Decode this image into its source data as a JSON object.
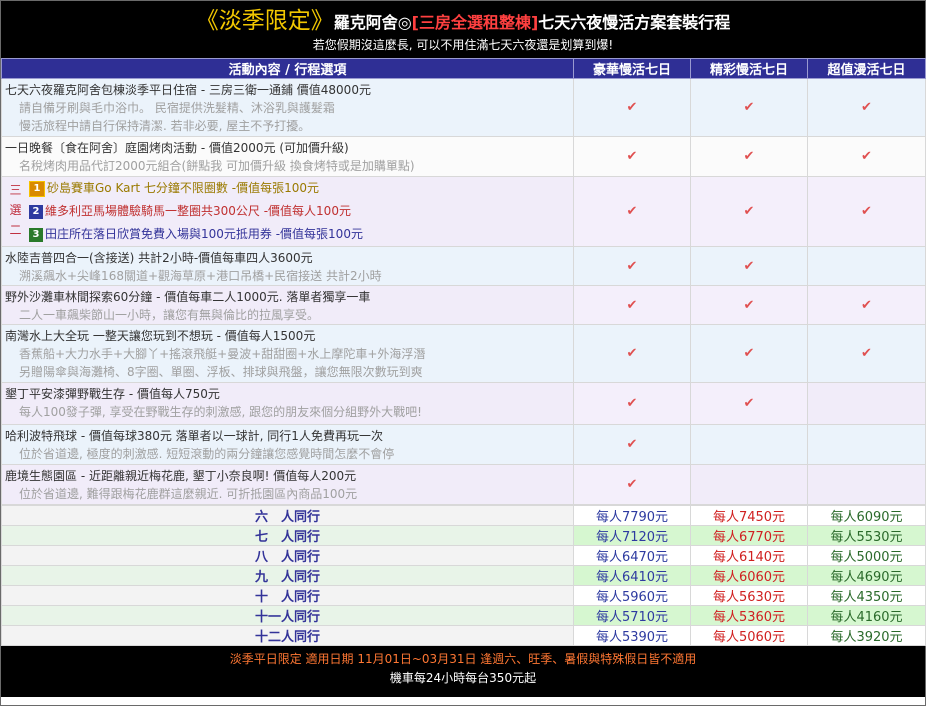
{
  "header": {
    "title_tag": "《淡季限定》",
    "title_brand": "羅克阿舍◎",
    "title_highlight": "[三房全選租整棟]",
    "title_tail": "七天六夜慢活方案套裝行程",
    "subtitle": "若您假期沒這麼長, 可以不用住滿七天六夜還是划算到爆!"
  },
  "columns": {
    "activity": "活動內容 / 行程選項",
    "plan1": "豪華慢活七日",
    "plan2": "精彩慢活七日",
    "plan3": "超值漫活七日"
  },
  "check_glyph": "✔",
  "activities": {
    "a1": {
      "line1": "七天六夜羅克阿舍包棟淡季平日住宿 - 三房三衛一通鋪  價值48000元",
      "line2": "請自備牙刷與毛巾浴巾。 民宿提供洗髮精、沐浴乳與護髮霜",
      "line3": "慢活旅程中請自行保持清潔. 若非必要, 屋主不予打擾。"
    },
    "a2": {
      "line1": "一日晚餐〔食在阿舍〕庭園烤肉活動 - 價值2000元 (可加價升級)",
      "line2": "名稅烤肉用品代訂2000元組合(餅點我 可加價升級 換食烤特或是加購單點)"
    },
    "choose": {
      "label": "三選二",
      "i1": "砂島賽車Go Kart 七分鐘不限圈數 -價值每張100元",
      "i2": "維多利亞馬場體驗騎馬一整圈共300公尺 -價值每人100元",
      "i3": "田庄所在落日欣賞免費入場與100元抵用券 -價值每張100元"
    },
    "a4": {
      "line1": "水陸吉普四合一(含接送) 共計2小時-價值每車四人3600元",
      "line2": "溯溪飆水+尖峰168關道+觀海草原+港口吊橋+民宿接送 共計2小時"
    },
    "a5": {
      "line1": "野外沙灘車林間探索60分鐘 - 價值每車二人1000元. 落單者獨享一車",
      "line2": "二人一車飆柴節山一小時，讓您有無與倫比的拉風享受。"
    },
    "a6": {
      "line1": "南灣水上大全玩 一整天讓您玩到不想玩 - 價值每人1500元",
      "line2": "香蕉船+大力水手+大腳丫+搖滾飛艇+曼波+甜甜圈+水上摩陀車+外海浮潛",
      "line3": "另贈陽傘與海灘椅、8字圈、單圈、浮板、排球與飛盤，讓您無限次數玩到爽"
    },
    "a7": {
      "line1": "墾丁平安漆彈野戰生存 - 價值每人750元",
      "line2": "每人100發子彈, 享受在野戰生存的刺激感, 跟您的朋友來個分組野外大戰吧!"
    },
    "a8": {
      "line1": "哈利波特飛球 - 價值每球380元 落單者以一球計, 同行1人免費再玩一次",
      "line2": "位於省道邊, 極度的刺激感. 短短滾動的兩分鐘讓您感覺時間怎麼不會停"
    },
    "a9": {
      "line1": "鹿境生態園區 - 近距離親近梅花鹿, 墾丁小奈良啊! 價值每人200元",
      "line2": "位於省道邊, 難得跟梅花鹿群這麼親近. 可折抵園區內商品100元"
    }
  },
  "prices": [
    {
      "label": "六　人同行",
      "p1": "每人7790元",
      "p2": "每人7450元",
      "p3": "每人6090元"
    },
    {
      "label": "七　人同行",
      "p1": "每人7120元",
      "p2": "每人6770元",
      "p3": "每人5530元"
    },
    {
      "label": "八　人同行",
      "p1": "每人6470元",
      "p2": "每人6140元",
      "p3": "每人5000元"
    },
    {
      "label": "九　人同行",
      "p1": "每人6410元",
      "p2": "每人6060元",
      "p3": "每人4690元"
    },
    {
      "label": "十　人同行",
      "p1": "每人5960元",
      "p2": "每人5630元",
      "p3": "每人4350元"
    },
    {
      "label": "十一人同行",
      "p1": "每人5710元",
      "p2": "每人5360元",
      "p3": "每人4160元"
    },
    {
      "label": "十二人同行",
      "p1": "每人5390元",
      "p2": "每人5060元",
      "p3": "每人3920元"
    }
  ],
  "footer": {
    "line1": "淡季平日限定 適用日期 11月01日~03月31日 逢週六、旺季、暑假與特殊假日皆不適用",
    "line2": "機車每24小時每台350元起"
  }
}
